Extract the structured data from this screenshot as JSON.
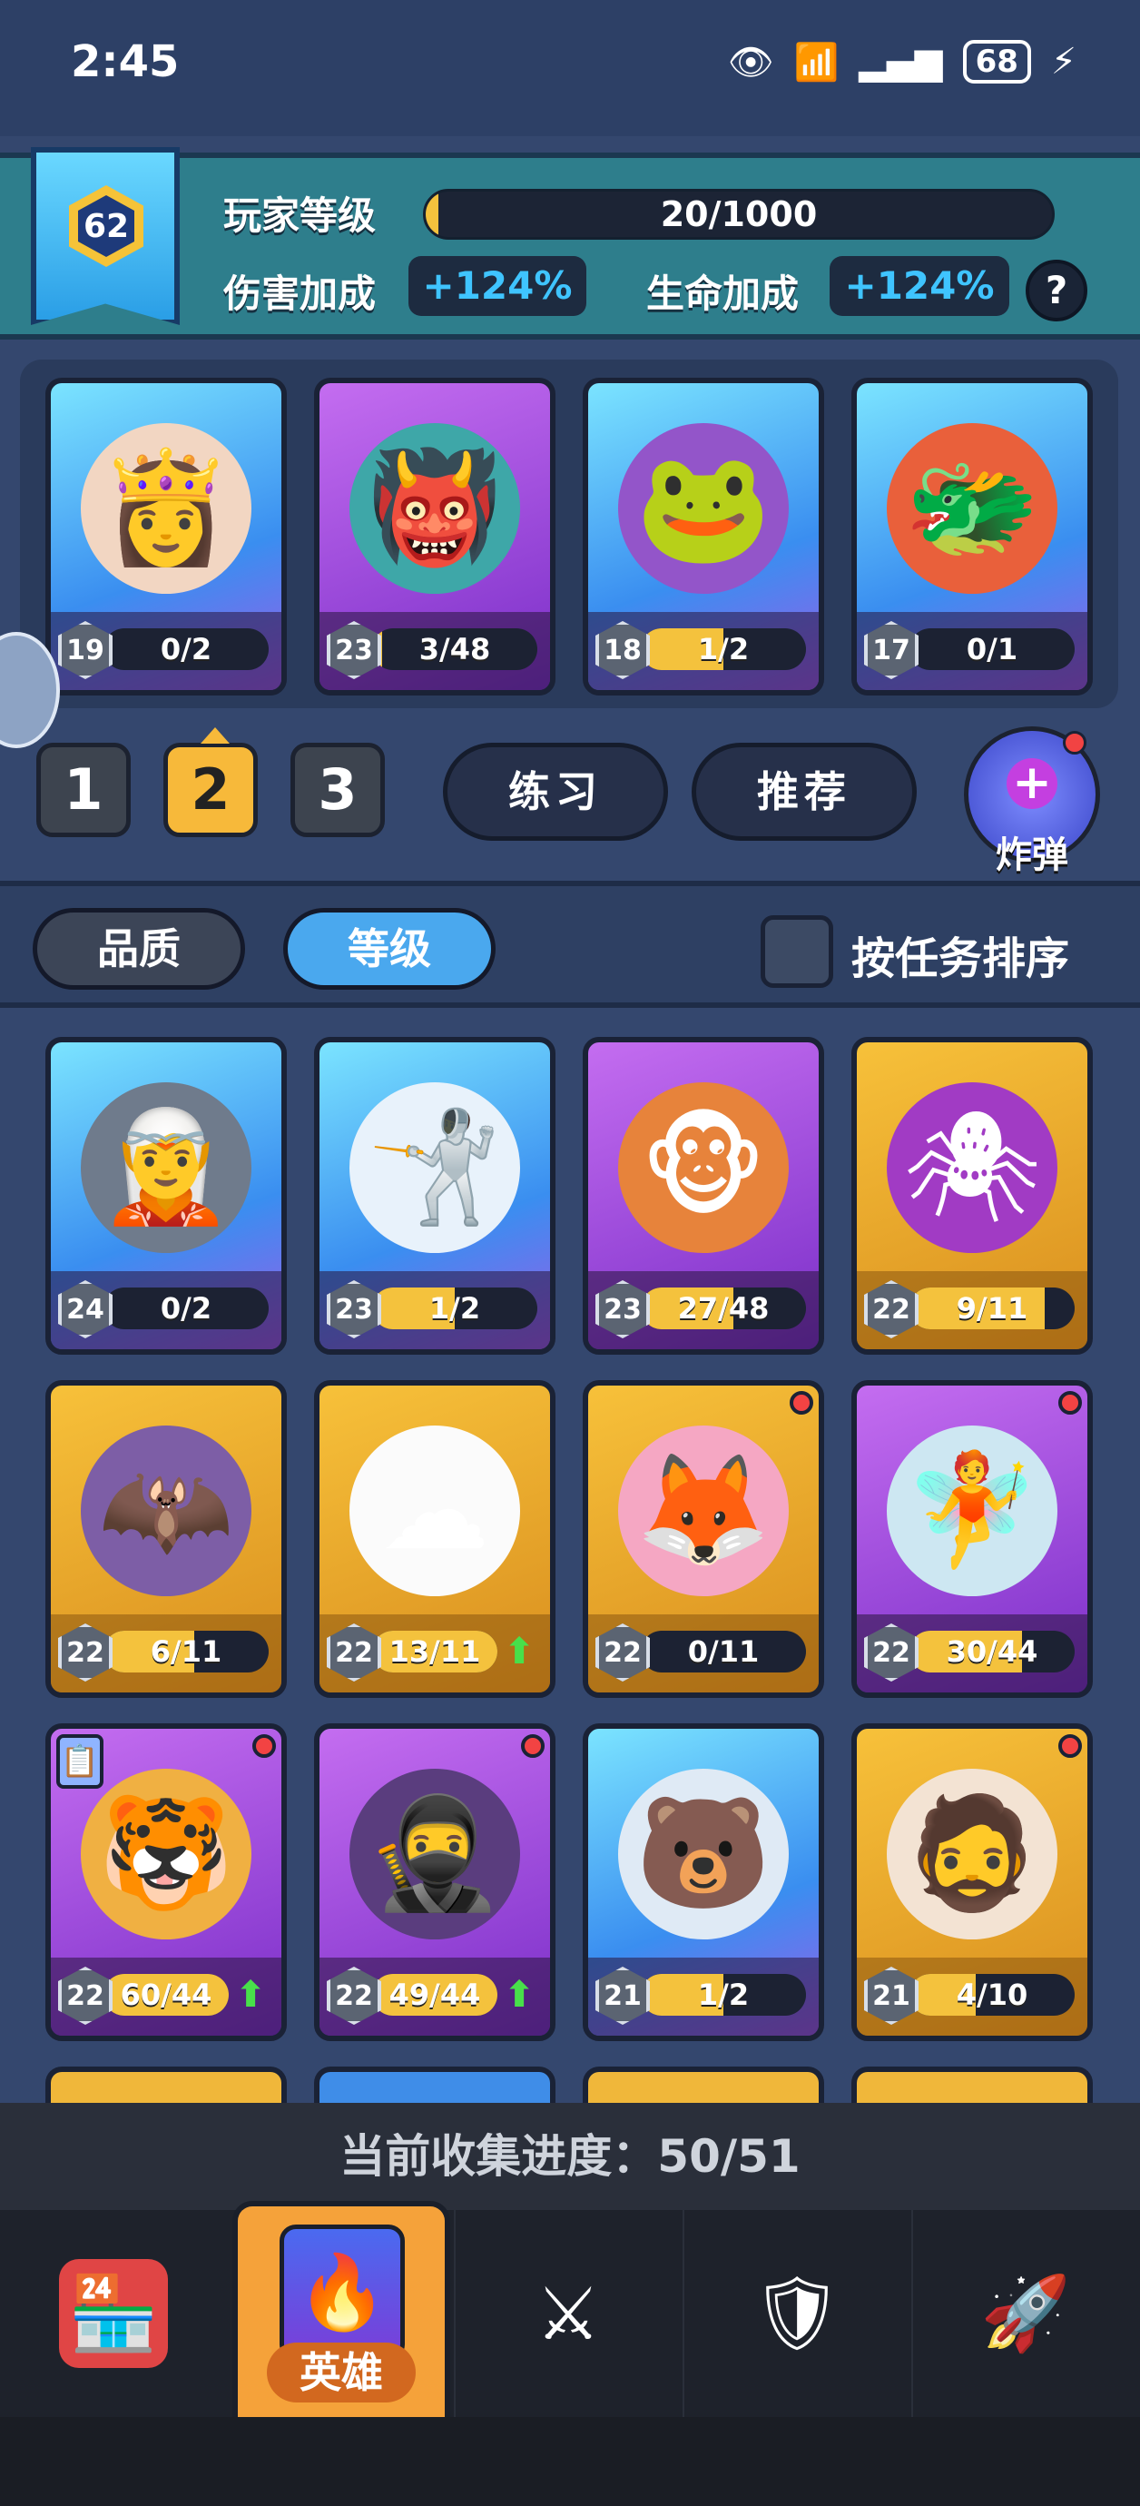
{
  "status_bar": {
    "time": "2:45",
    "battery": "68"
  },
  "player": {
    "level": "62",
    "level_label": "玩家等级",
    "exp_text": "20/1000",
    "exp_progress": 0.02,
    "damage_label": "伤害加成",
    "damage_value": "+124%",
    "health_label": "生命加成",
    "health_value": "+124%",
    "help": "?"
  },
  "team": [
    {
      "level": "19",
      "progress": "0/2",
      "fill": 0.0,
      "rarity": "blue",
      "icon": "hero-princess-icon",
      "glyph": "👸"
    },
    {
      "level": "23",
      "progress": "3/48",
      "fill": 0.06,
      "rarity": "purple",
      "icon": "hero-orc-pirate-icon",
      "glyph": "👹"
    },
    {
      "level": "18",
      "progress": "1/2",
      "fill": 0.5,
      "rarity": "blue",
      "icon": "hero-frog-icon",
      "glyph": "🐸"
    },
    {
      "level": "17",
      "progress": "0/1",
      "fill": 0.0,
      "rarity": "blue",
      "icon": "hero-chef-dragon-icon",
      "glyph": "🐲"
    }
  ],
  "team_tabs": [
    "1",
    "2",
    "3"
  ],
  "active_team_tab": 1,
  "actions": {
    "practice": "练习",
    "recommend": "推荐",
    "bomb": "炸弹",
    "bomb_plus": "+"
  },
  "sort": {
    "quality": "品质",
    "level": "等级",
    "by_task": "按任务排序"
  },
  "heroes": [
    {
      "level": "24",
      "progress": "0/2",
      "fill": 0.0,
      "rarity": "blue",
      "icon": "hero-ice-elf-icon",
      "glyph": "🧝",
      "dot": false,
      "upgrade": false
    },
    {
      "level": "23",
      "progress": "1/2",
      "fill": 0.5,
      "rarity": "blue",
      "icon": "hero-ice-knight-icon",
      "glyph": "🤺",
      "dot": false,
      "upgrade": false
    },
    {
      "level": "23",
      "progress": "27/48",
      "fill": 0.56,
      "rarity": "purple",
      "icon": "hero-fire-monkey-icon",
      "glyph": "🐵",
      "dot": false,
      "upgrade": false
    },
    {
      "level": "22",
      "progress": "9/11",
      "fill": 0.82,
      "rarity": "gold",
      "icon": "hero-spider-icon",
      "glyph": "🕷",
      "dot": false,
      "upgrade": false
    },
    {
      "level": "22",
      "progress": "6/11",
      "fill": 0.55,
      "rarity": "gold",
      "icon": "hero-bat-icon",
      "glyph": "🦇",
      "dot": false,
      "upgrade": false
    },
    {
      "level": "22",
      "progress": "13/11",
      "fill": 1.0,
      "rarity": "gold",
      "icon": "hero-cloud-icon",
      "glyph": "☁",
      "dot": false,
      "upgrade": true
    },
    {
      "level": "22",
      "progress": "0/11",
      "fill": 0.0,
      "rarity": "gold",
      "icon": "hero-fox-girl-icon",
      "glyph": "🦊",
      "dot": true,
      "upgrade": false
    },
    {
      "level": "22",
      "progress": "30/44",
      "fill": 0.68,
      "rarity": "purple",
      "icon": "hero-crystal-elf-icon",
      "glyph": "🧚",
      "dot": true,
      "upgrade": false
    },
    {
      "level": "22",
      "progress": "60/44",
      "fill": 1.0,
      "rarity": "purple",
      "icon": "hero-tiger-pirate-icon",
      "glyph": "🐯",
      "dot": true,
      "upgrade": true,
      "task": true
    },
    {
      "level": "22",
      "progress": "49/44",
      "fill": 1.0,
      "rarity": "purple",
      "icon": "hero-ronin-icon",
      "glyph": "🥷",
      "dot": true,
      "upgrade": true
    },
    {
      "level": "21",
      "progress": "1/2",
      "fill": 0.5,
      "rarity": "blue",
      "icon": "hero-polar-bear-icon",
      "glyph": "🐻",
      "dot": false,
      "upgrade": false
    },
    {
      "level": "21",
      "progress": "4/10",
      "fill": 0.4,
      "rarity": "gold",
      "icon": "hero-old-dwarf-icon",
      "glyph": "🧔",
      "dot": true,
      "upgrade": false
    }
  ],
  "collection": "当前收集进度：50/51",
  "nav": {
    "shop_icon": "shop-icon",
    "hero_label": "英雄",
    "battle_icon": "crossed-swords-icon",
    "clan_icon": "shield-icon",
    "event_icon": "rocket-icon"
  }
}
